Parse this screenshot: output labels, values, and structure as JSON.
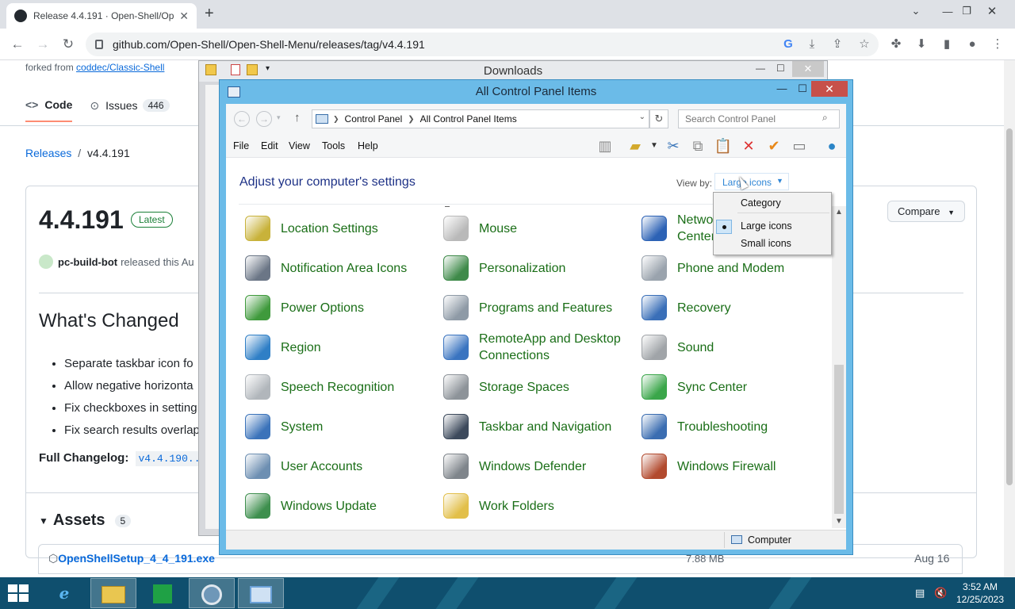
{
  "browser": {
    "tab_title": "Release 4.4.191 · Open-Shell/Op",
    "tab_close": "✕",
    "new_tab": "+",
    "url": "github.com/Open-Shell/Open-Shell-Menu/releases/tag/v4.4.191"
  },
  "github": {
    "forked_prefix": "forked from",
    "forked_repo": "coddec/Classic-Shell",
    "tab_code": "Code",
    "tab_issues": "Issues",
    "issues_count": "446",
    "crumb_releases": "Releases",
    "crumb_sep": "/",
    "crumb_version": "v4.4.191",
    "release_title": "4.4.191",
    "latest_badge": "Latest",
    "compare_label": "Compare",
    "author": "pc-build-bot",
    "author_text": "released this Au",
    "whats_changed": "What's Changed",
    "bullets": [
      "Separate taskbar icon fo",
      "Allow negative horizonta",
      "Fix checkboxes in setting",
      "Fix search results overlap"
    ],
    "full_changelog_label": "Full Changelog:",
    "full_changelog_link": "v4.4.190...",
    "assets_label": "Assets",
    "assets_count": "5",
    "asset_name": "OpenShellSetup_4_4_191.exe",
    "asset_size": "7.88 MB",
    "asset_date": "Aug 16"
  },
  "downloads_window": {
    "title": "Downloads",
    "close": "✕"
  },
  "control_panel": {
    "title": "All Control Panel Items",
    "address": {
      "part1": "Control Panel",
      "part2": "All Control Panel Items"
    },
    "search_placeholder": "Search Control Panel",
    "menu": [
      "File",
      "Edit",
      "View",
      "Tools",
      "Help"
    ],
    "heading": "Adjust your computer's settings",
    "view_by_label": "View by:",
    "view_by_value": "Large icons",
    "items": [
      {
        "label": "Location Settings",
        "icon": "location-icon",
        "color": "#c8b23a"
      },
      {
        "label": "Mouse",
        "icon": "mouse-icon",
        "color": "#b9b9b9"
      },
      {
        "label": "Network and Sharing Center",
        "icon": "network-icon",
        "color": "#2c62b5"
      },
      {
        "label": "Notification Area Icons",
        "icon": "notification-icon",
        "color": "#6b7686"
      },
      {
        "label": "Personalization",
        "icon": "personalization-icon",
        "color": "#3f8a4a"
      },
      {
        "label": "Phone and Modem",
        "icon": "phone-icon",
        "color": "#9aa3ad"
      },
      {
        "label": "Power Options",
        "icon": "power-icon",
        "color": "#3f9a3c"
      },
      {
        "label": "Programs and Features",
        "icon": "programs-icon",
        "color": "#8e9aa6"
      },
      {
        "label": "Recovery",
        "icon": "recovery-icon",
        "color": "#3a6fb8"
      },
      {
        "label": "Region",
        "icon": "region-icon",
        "color": "#2f7fc6"
      },
      {
        "label": "RemoteApp and Desktop Connections",
        "icon": "remoteapp-icon",
        "color": "#3a74c0"
      },
      {
        "label": "Sound",
        "icon": "sound-icon",
        "color": "#a0a4a8"
      },
      {
        "label": "Speech Recognition",
        "icon": "microphone-icon",
        "color": "#b1b6bb"
      },
      {
        "label": "Storage Spaces",
        "icon": "storage-icon",
        "color": "#8d9399"
      },
      {
        "label": "Sync Center",
        "icon": "sync-icon",
        "color": "#3aa64a"
      },
      {
        "label": "System",
        "icon": "system-icon",
        "color": "#3b73ba"
      },
      {
        "label": "Taskbar and Navigation",
        "icon": "taskbar-icon",
        "color": "#3d4a5c"
      },
      {
        "label": "Troubleshooting",
        "icon": "troubleshooting-icon",
        "color": "#3b6db1"
      },
      {
        "label": "User Accounts",
        "icon": "user-accounts-icon",
        "color": "#6d8fb2"
      },
      {
        "label": "Windows Defender",
        "icon": "defender-icon",
        "color": "#7f858b"
      },
      {
        "label": "Windows Firewall",
        "icon": "firewall-icon",
        "color": "#b24a2e"
      },
      {
        "label": "Windows Update",
        "icon": "update-icon",
        "color": "#3e8f4e"
      },
      {
        "label": "Work Folders",
        "icon": "folder-icon",
        "color": "#e2bf4a"
      }
    ],
    "view_options": [
      "Category",
      "Large icons",
      "Small icons"
    ],
    "status_label": "Computer"
  },
  "taskbar": {
    "time": "3:52 AM",
    "date": "12/25/2023"
  }
}
